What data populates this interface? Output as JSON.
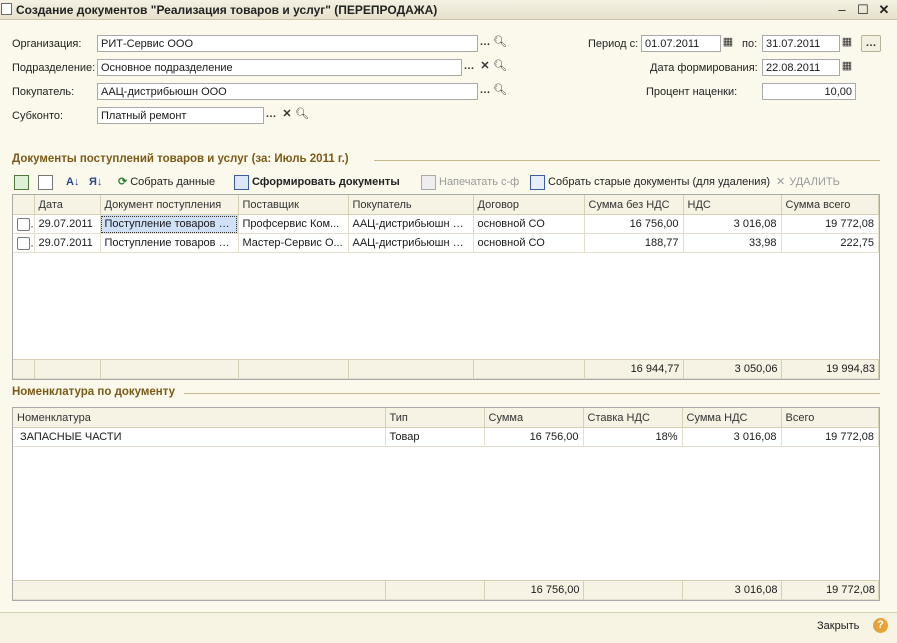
{
  "window": {
    "title": "Создание документов \"Реализация товаров и услуг\" (ПЕРЕПРОДАЖА)"
  },
  "form": {
    "org_label": "Организация:",
    "org_value": "РИТ-Сервис ООО",
    "dept_label": "Подразделение:",
    "dept_value": "Основное подразделение",
    "buyer_label": "Покупатель:",
    "buyer_value": "ААЦ-дистрибьюшн ООО",
    "subkonto_label": "Субконто:",
    "subkonto_value": "Платный ремонт",
    "period_label": "Период с:",
    "period_from": "01.07.2011",
    "to_label": "по:",
    "period_to": "31.07.2011",
    "date_form_label": "Дата формирования:",
    "date_form_value": "22.08.2011",
    "markup_label": "Процент наценки:",
    "markup_value": "10,00"
  },
  "section1": {
    "title": "Документы поступлений товаров и услуг (за: Июль 2011 г.)"
  },
  "toolbar": {
    "collect": "Собрать данные",
    "form_docs": "Сформировать документы",
    "print_sf": "Напечатать с-ф",
    "collect_old": "Собрать старые документы (для удаления)",
    "delete": "УДАЛИТЬ"
  },
  "table1": {
    "headers": [
      "",
      "Дата",
      "Документ поступления",
      "Поставщик",
      "Покупатель",
      "Договор",
      "Сумма без НДС",
      "НДС",
      "Сумма всего"
    ],
    "rows": [
      [
        "",
        "29.07.2011",
        "Поступление товаров и...",
        "Профсервис Ком...",
        "ААЦ-дистрибьюшн О...",
        "основной СО",
        "16 756,00",
        "3 016,08",
        "19 772,08"
      ],
      [
        "",
        "29.07.2011",
        "Поступление товаров и...",
        "Мастер-Сервис О...",
        "ААЦ-дистрибьюшн О...",
        "основной СО",
        "188,77",
        "33,98",
        "222,75"
      ]
    ],
    "totals": [
      "",
      "",
      "",
      "",
      "",
      "",
      "16 944,77",
      "3 050,06",
      "19 994,83"
    ]
  },
  "section2": {
    "title": "Номенклатура по документу"
  },
  "table2": {
    "headers": [
      "Номенклатура",
      "Тип",
      "Сумма",
      "Ставка НДС",
      "Сумма НДС",
      "Всего"
    ],
    "rows": [
      [
        "ЗАПАСНЫЕ ЧАСТИ",
        "Товар",
        "16 756,00",
        "18%",
        "3 016,08",
        "19 772,08"
      ]
    ],
    "totals": [
      "",
      "",
      "16 756,00",
      "",
      "3 016,08",
      "19 772,08"
    ]
  },
  "footer": {
    "close": "Закрыть",
    "help": "?"
  }
}
